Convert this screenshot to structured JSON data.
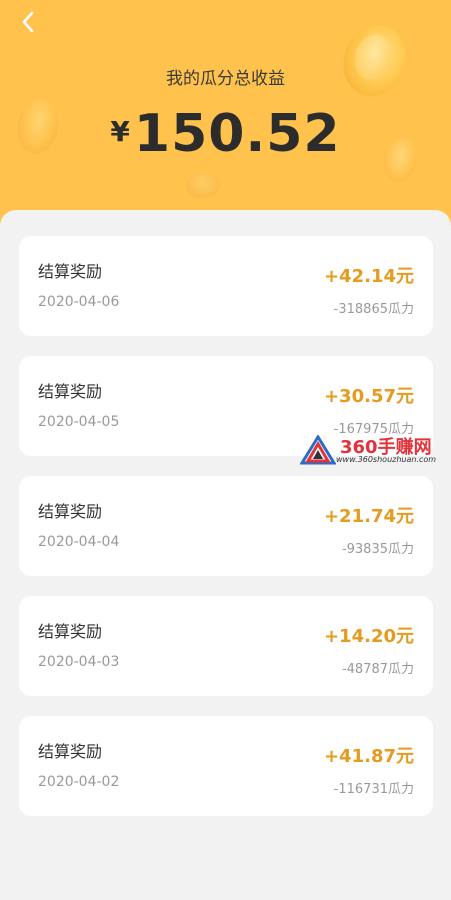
{
  "header": {
    "title": "我的瓜分总收益",
    "currency": "¥",
    "total": "150.52"
  },
  "records": [
    {
      "title": "结算奖励",
      "date": "2020-04-06",
      "reward": "+42.14元",
      "points": "-318865瓜力"
    },
    {
      "title": "结算奖励",
      "date": "2020-04-05",
      "reward": "+30.57元",
      "points": "-167975瓜力"
    },
    {
      "title": "结算奖励",
      "date": "2020-04-04",
      "reward": "+21.74元",
      "points": "-93835瓜力"
    },
    {
      "title": "结算奖励",
      "date": "2020-04-03",
      "reward": "+14.20元",
      "points": "-48787瓜力"
    },
    {
      "title": "结算奖励",
      "date": "2020-04-02",
      "reward": "+41.87元",
      "points": "-116731瓜力"
    }
  ],
  "watermark": {
    "text": "360手赚网",
    "url": "www.360shouzhuan.com"
  },
  "colors": {
    "header_bg": "#ffc24d",
    "reward": "#e69a1e",
    "page_bg": "#f2f2f2"
  }
}
